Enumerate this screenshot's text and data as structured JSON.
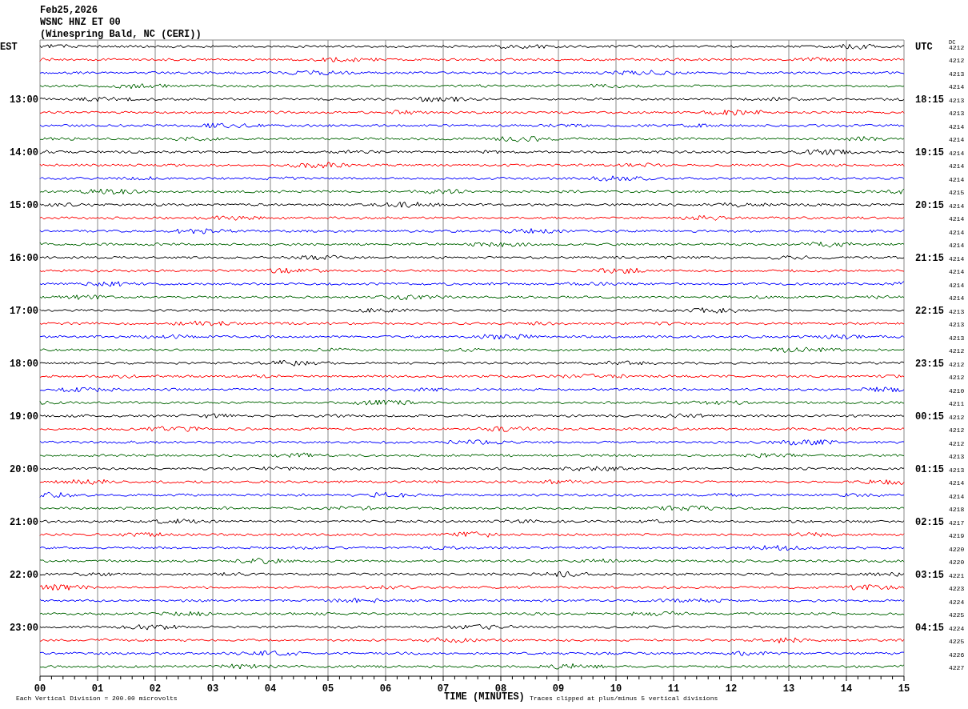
{
  "header": [
    "Feb25,2026",
    "WSNC HNZ ET 00",
    "(Winespring Bald, NC (CERI))"
  ],
  "dc_header": "DC",
  "rows": [
    {
      "left": "EST",
      "right": "UTC",
      "dc": "4212",
      "color": "#000000"
    },
    {
      "dc": "4212",
      "color": "#ff0000"
    },
    {
      "dc": "4213",
      "color": "#0000ff"
    },
    {
      "dc": "4214",
      "color": "#006400"
    },
    {
      "left": "13:00",
      "right": "18:15",
      "dc": "4213",
      "color": "#000000"
    },
    {
      "dc": "4213",
      "color": "#ff0000"
    },
    {
      "dc": "4214",
      "color": "#0000ff"
    },
    {
      "dc": "4214",
      "color": "#006400"
    },
    {
      "left": "14:00",
      "right": "19:15",
      "dc": "4214",
      "color": "#000000"
    },
    {
      "dc": "4214",
      "color": "#ff0000"
    },
    {
      "dc": "4214",
      "color": "#0000ff"
    },
    {
      "dc": "4215",
      "color": "#006400"
    },
    {
      "left": "15:00",
      "right": "20:15",
      "dc": "4214",
      "color": "#000000"
    },
    {
      "dc": "4214",
      "color": "#ff0000"
    },
    {
      "dc": "4214",
      "color": "#0000ff"
    },
    {
      "dc": "4214",
      "color": "#006400"
    },
    {
      "left": "16:00",
      "right": "21:15",
      "dc": "4214",
      "color": "#000000"
    },
    {
      "dc": "4214",
      "color": "#ff0000"
    },
    {
      "dc": "4214",
      "color": "#0000ff"
    },
    {
      "dc": "4214",
      "color": "#006400"
    },
    {
      "left": "17:00",
      "right": "22:15",
      "dc": "4213",
      "color": "#000000"
    },
    {
      "dc": "4213",
      "color": "#ff0000"
    },
    {
      "dc": "4213",
      "color": "#0000ff"
    },
    {
      "dc": "4212",
      "color": "#006400"
    },
    {
      "left": "18:00",
      "right": "23:15",
      "dc": "4212",
      "color": "#000000"
    },
    {
      "dc": "4212",
      "color": "#ff0000"
    },
    {
      "dc": "4210",
      "color": "#0000ff"
    },
    {
      "dc": "4211",
      "color": "#006400"
    },
    {
      "left": "19:00",
      "right": "00:15",
      "dc": "4212",
      "color": "#000000"
    },
    {
      "dc": "4212",
      "color": "#ff0000"
    },
    {
      "dc": "4212",
      "color": "#0000ff"
    },
    {
      "dc": "4213",
      "color": "#006400"
    },
    {
      "left": "20:00",
      "right": "01:15",
      "dc": "4213",
      "color": "#000000"
    },
    {
      "dc": "4214",
      "color": "#ff0000"
    },
    {
      "dc": "4214",
      "color": "#0000ff"
    },
    {
      "dc": "4218",
      "color": "#006400"
    },
    {
      "left": "21:00",
      "right": "02:15",
      "dc": "4217",
      "color": "#000000"
    },
    {
      "dc": "4219",
      "color": "#ff0000"
    },
    {
      "dc": "4220",
      "color": "#0000ff"
    },
    {
      "dc": "4220",
      "color": "#006400"
    },
    {
      "left": "22:00",
      "right": "03:15",
      "dc": "4221",
      "color": "#000000"
    },
    {
      "dc": "4223",
      "color": "#ff0000"
    },
    {
      "dc": "4224",
      "color": "#0000ff"
    },
    {
      "dc": "4225",
      "color": "#006400"
    },
    {
      "left": "23:00",
      "right": "04:15",
      "dc": "4224",
      "color": "#000000"
    },
    {
      "dc": "4225",
      "color": "#ff0000"
    },
    {
      "dc": "4226",
      "color": "#0000ff"
    },
    {
      "dc": "4227",
      "color": "#006400"
    }
  ],
  "x_axis_labels": [
    "00",
    "01",
    "02",
    "03",
    "04",
    "05",
    "06",
    "07",
    "08",
    "09",
    "10",
    "11",
    "12",
    "13",
    "14",
    "15"
  ],
  "footer": {
    "scale_note": "Each Vertical Division =  200.00 microvolts",
    "axis_title": "TIME (MINUTES)",
    "clip_note": "Traces clipped at plus/minus 5 vertical divisions"
  }
}
